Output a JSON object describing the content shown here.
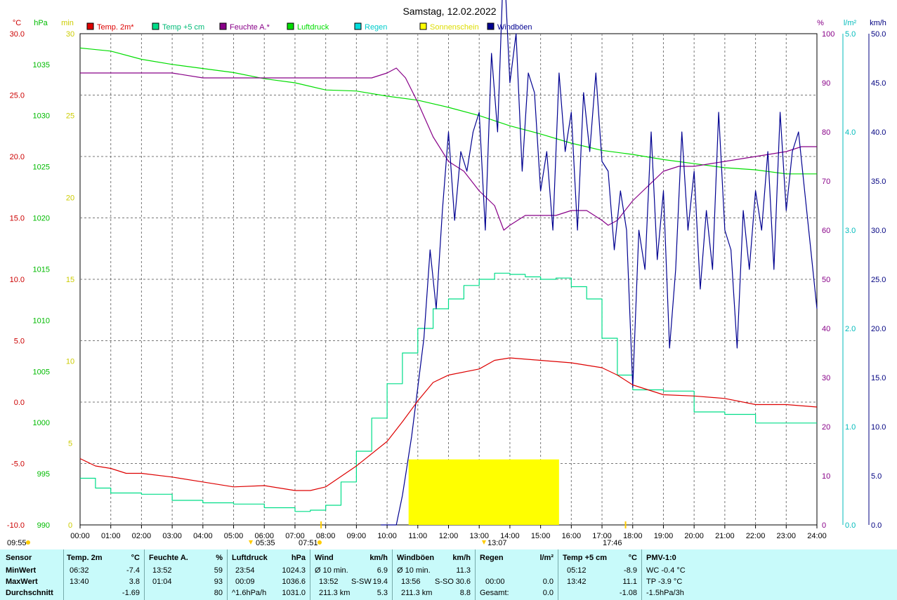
{
  "title": "Samstag, 12.02.2022",
  "axes": {
    "temp": {
      "unit": "°C",
      "min": -10,
      "max": 30,
      "ticks": [
        -10,
        -5,
        0,
        5,
        10,
        15,
        20,
        25,
        30
      ],
      "labels": [
        "-10.0",
        "-5.0",
        "0.0",
        "5.0",
        "10.0",
        "15.0",
        "20.0",
        "25.0",
        "30.0"
      ],
      "color": "#cc0000"
    },
    "pressure": {
      "unit": "hPa",
      "min": 990,
      "max": 1038,
      "ticks": [
        990,
        995,
        1000,
        1005,
        1010,
        1015,
        1020,
        1025,
        1030,
        1035
      ],
      "labels": [
        "990",
        "995",
        "1000",
        "1005",
        "1010",
        "1015",
        "1020",
        "1025",
        "1030",
        "1035"
      ],
      "color": "#00cc00"
    },
    "sun": {
      "unit": "min",
      "min": 0,
      "max": 30,
      "ticks": [
        0,
        5,
        10,
        15,
        20,
        25,
        30
      ],
      "labels": [
        "0",
        "5",
        "10",
        "15",
        "20",
        "25",
        "30"
      ],
      "color": "#dddd00"
    },
    "humidity": {
      "unit": "%",
      "min": 0,
      "max": 100,
      "ticks": [
        0,
        10,
        20,
        30,
        40,
        50,
        60,
        70,
        80,
        90,
        100
      ],
      "labels": [
        "0",
        "10",
        "20",
        "30",
        "40",
        "50",
        "60",
        "70",
        "80",
        "90",
        "100"
      ],
      "color": "#880088"
    },
    "rain": {
      "unit": "l/m²",
      "min": 0,
      "max": 5,
      "ticks": [
        0,
        1,
        2,
        3,
        4,
        5
      ],
      "labels": [
        "0.0",
        "1.0",
        "2.0",
        "3.0",
        "4.0",
        "5.0"
      ],
      "color": "#00cccc"
    },
    "wind": {
      "unit": "km/h",
      "min": 0,
      "max": 50,
      "ticks": [
        0,
        5,
        10,
        15,
        20,
        25,
        30,
        35,
        40,
        45,
        50
      ],
      "labels": [
        "0.0",
        "5.0",
        "10.0",
        "15.0",
        "20.0",
        "25.0",
        "30.0",
        "35.0",
        "40.0",
        "45.0",
        "50.0"
      ],
      "color": "#000080"
    },
    "time_labels": [
      "00:00",
      "01:00",
      "02:00",
      "03:00",
      "04:00",
      "05:00",
      "06:00",
      "07:00",
      "08:00",
      "09:00",
      "10:00",
      "11:00",
      "12:00",
      "13:00",
      "14:00",
      "15:00",
      "16:00",
      "17:00",
      "18:00",
      "19:00",
      "20:00",
      "21:00",
      "22:00",
      "23:00",
      "24:00"
    ]
  },
  "legend": [
    {
      "label": "Temp. 2m*",
      "color": "#dd0000"
    },
    {
      "label": "Temp +5 cm",
      "color": "#00dd88"
    },
    {
      "label": "Feuchte A.*",
      "color": "#880088"
    },
    {
      "label": "Luftdruck",
      "color": "#00dd00"
    },
    {
      "label": "Regen",
      "color": "#00dddd"
    },
    {
      "label": "Sonnenschein",
      "color": "#ffff00"
    },
    {
      "label": "Windböen",
      "color": "#000090"
    }
  ],
  "markers": {
    "sunrise_label": "07:51",
    "sunset_label": "17:46",
    "left_time": "09:55",
    "temp_min_label": "05:35",
    "temp_max_label": "13:07"
  },
  "chart_data": {
    "type": "line",
    "title": "Samstag, 12.02.2022",
    "x_unit": "hours",
    "series": [
      {
        "name": "Temp. 2m*",
        "axis": "temp",
        "color": "#dd0000",
        "x": [
          0,
          0.5,
          1,
          1.5,
          2,
          3,
          4,
          5,
          6,
          7,
          7.5,
          8,
          9,
          10,
          10.5,
          11,
          11.5,
          12,
          13,
          13.5,
          14,
          15,
          16,
          16.5,
          17,
          17.5,
          18,
          19,
          20,
          21,
          22,
          23,
          24
        ],
        "values": [
          -4.6,
          -5.2,
          -5.4,
          -5.8,
          -5.8,
          -6.1,
          -6.5,
          -6.9,
          -6.8,
          -7.2,
          -7.2,
          -6.9,
          -5.2,
          -3.2,
          -1.6,
          0.1,
          1.6,
          2.2,
          2.7,
          3.4,
          3.6,
          3.4,
          3.2,
          3.0,
          2.8,
          2.2,
          1.4,
          0.6,
          0.5,
          0.3,
          -0.2,
          -0.2,
          -0.4
        ]
      },
      {
        "name": "Temp +5 cm",
        "axis": "temp",
        "color": "#00dd88",
        "x": [
          0,
          0.5,
          1,
          2,
          3,
          4,
          5,
          6,
          7,
          7.5,
          8,
          8.5,
          9,
          9.5,
          10,
          10.5,
          11,
          11.5,
          12,
          12.5,
          13,
          13.5,
          14,
          14.5,
          15,
          15.5,
          16,
          16.5,
          17,
          17.5,
          18,
          19,
          20,
          21,
          22,
          23,
          24
        ],
        "values": [
          -6.2,
          -7.0,
          -7.4,
          -7.5,
          -8.0,
          -8.2,
          -8.3,
          -8.6,
          -8.9,
          -8.8,
          -8.4,
          -6.5,
          -4.0,
          -1.3,
          1.5,
          4.0,
          6.0,
          7.6,
          8.4,
          9.5,
          10.0,
          10.5,
          10.4,
          10.2,
          10.0,
          10.1,
          9.4,
          8.4,
          5.2,
          2.2,
          1.0,
          0.9,
          -0.8,
          -1.0,
          -1.7,
          -1.7,
          -1.7
        ]
      },
      {
        "name": "Feuchte A.*",
        "axis": "humidity",
        "color": "#880088",
        "x": [
          0,
          1,
          2,
          3,
          4,
          5,
          6,
          7,
          8,
          9,
          9.5,
          10,
          10.3,
          10.6,
          11,
          11.5,
          12,
          12.5,
          13,
          13.5,
          13.8,
          14,
          14.5,
          15,
          15.5,
          16,
          16.5,
          17,
          17.2,
          17.5,
          18,
          18.5,
          19,
          19.5,
          20,
          21,
          22,
          23,
          23.5,
          24
        ],
        "values": [
          92,
          92,
          92,
          92,
          91,
          91,
          91,
          91,
          91,
          91,
          91,
          92,
          93,
          91,
          86,
          79,
          74,
          72,
          68,
          65,
          60,
          61,
          63,
          63,
          63,
          64,
          64,
          62,
          61,
          62,
          66,
          69,
          72,
          73,
          73,
          74,
          75,
          76,
          77,
          77
        ]
      },
      {
        "name": "Luftdruck",
        "axis": "pressure",
        "color": "#00dd00",
        "x": [
          0,
          1,
          2,
          3,
          4,
          5,
          6,
          7,
          8,
          9,
          10,
          11,
          12,
          13,
          14,
          15,
          16,
          17,
          18,
          19,
          20,
          21,
          22,
          23,
          24
        ],
        "values": [
          1036.6,
          1036.3,
          1035.5,
          1035.0,
          1034.6,
          1034.2,
          1033.6,
          1033.2,
          1032.5,
          1032.4,
          1031.9,
          1031.5,
          1030.8,
          1030.0,
          1029.0,
          1028.2,
          1027.3,
          1026.6,
          1026.2,
          1025.7,
          1025.3,
          1024.9,
          1024.7,
          1024.3,
          1024.3
        ]
      },
      {
        "name": "Windböen",
        "axis": "wind",
        "color": "#000090",
        "x": [
          9.8,
          10.0,
          10.3,
          10.5,
          10.6,
          10.8,
          11,
          11.2,
          11.4,
          11.6,
          11.8,
          12,
          12.2,
          12.4,
          12.6,
          12.8,
          13,
          13.2,
          13.4,
          13.6,
          13.8,
          14,
          14.2,
          14.4,
          14.6,
          14.8,
          15,
          15.2,
          15.4,
          15.6,
          15.8,
          16,
          16.2,
          16.4,
          16.6,
          16.8,
          17,
          17.2,
          17.4,
          17.6,
          17.8,
          18,
          18.2,
          18.4,
          18.6,
          18.8,
          19,
          19.2,
          19.4,
          19.6,
          19.8,
          20,
          20.2,
          20.4,
          20.6,
          20.8,
          21,
          21.2,
          21.4,
          21.6,
          21.8,
          22,
          22.2,
          22.4,
          22.6,
          22.8,
          23,
          23.2,
          23.4,
          23.6,
          23.8,
          24
        ],
        "values": [
          0,
          0,
          0,
          3,
          5,
          9,
          14,
          19,
          28,
          22,
          32,
          40,
          31,
          38,
          36,
          40,
          42,
          30,
          48,
          40,
          58,
          45,
          50,
          36,
          46,
          44,
          34,
          38,
          30,
          46,
          38,
          42,
          30,
          44,
          38,
          46,
          37,
          36,
          28,
          34,
          30,
          14,
          30,
          26,
          40,
          27,
          34,
          18,
          26,
          40,
          30,
          36,
          24,
          32,
          26,
          42,
          30,
          28,
          18,
          32,
          26,
          34,
          30,
          38,
          26,
          42,
          32,
          38,
          40,
          34,
          28,
          22
        ]
      }
    ],
    "bars": [
      {
        "name": "Sonnenschein",
        "axis": "sun",
        "color": "#ffff00",
        "x_start": 10.7,
        "x_end": 15.6,
        "value": 4
      }
    ]
  },
  "stats": {
    "headers": {
      "sensor": "Sensor",
      "temp": "Temp. 2m",
      "temp_unit": "°C",
      "hum": "Feuchte A.",
      "hum_unit": "%",
      "press": "Luftdruck",
      "press_unit": "hPa",
      "wind": "Wind",
      "wind_unit": "km/h",
      "gust": "Windböen",
      "gust_unit": "km/h",
      "rain": "Regen",
      "rain_unit": "l/m²",
      "t5": "Temp +5 cm",
      "t5_unit": "°C",
      "pmv": "PMV-1:0"
    },
    "rows": {
      "min": "MinWert",
      "max": "MaxWert",
      "avg": "Durchschnitt"
    },
    "temp": {
      "min_t": "06:32",
      "min_v": "-7.4",
      "max_t": "13:40",
      "max_v": "3.8",
      "avg_v": "-1.69"
    },
    "hum": {
      "min_t": "13:52",
      "min_v": "59",
      "max_t": "01:04",
      "max_v": "93",
      "avg_v": "80"
    },
    "press": {
      "min_t": "23:54",
      "min_v": "1024.3",
      "max_t": "00:09",
      "max_v": "1036.6",
      "avg_t": "^1.6hPa/h",
      "avg_v": "1031.0"
    },
    "wind": {
      "min_t": "Ø 10 min.",
      "min_v": "6.9",
      "max_t": "13:52",
      "max_d": "S-SW",
      "max_v": "19.4",
      "avg_t": "211.3 km",
      "avg_v": "5.3"
    },
    "gust": {
      "min_t": "Ø 10 min.",
      "min_v": "11.3",
      "max_t": "13:56",
      "max_d": "S-SO",
      "max_v": "30.6",
      "avg_t": "211.3 km",
      "avg_v": "8.8"
    },
    "rain": {
      "max_t": "00:00",
      "max_v": "0.0",
      "avg_t": "Gesamt:",
      "avg_v": "0.0"
    },
    "t5": {
      "min_t": "05:12",
      "min_v": "-8.9",
      "max_t": "13:42",
      "max_v": "11.1",
      "avg_v": "-1.08"
    },
    "pmv": {
      "l1": "WC -0.4 °C",
      "l2": "TP -3.9 °C",
      "l3": "-1.5hPa/3h"
    }
  }
}
